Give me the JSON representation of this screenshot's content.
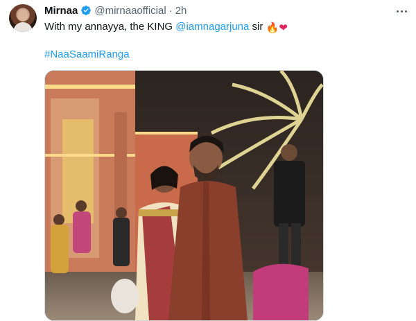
{
  "tweet": {
    "author_name": "Mirnaa",
    "handle": "@mirnaaofficial",
    "separator": "·",
    "time": "2h",
    "text_before": "With my annayya, the KING ",
    "mention": "@iamnagarjuna",
    "text_after": " sir ",
    "emoji_fire": "🔥",
    "emoji_heart": "❤",
    "hashtag": "#NaaSaamiRanga"
  },
  "icons": {
    "avatar": "profile-photo",
    "verified": "verified-badge-icon",
    "more": "more-options-icon"
  },
  "colors": {
    "link": "#1d9bf0",
    "secondary_text": "#536471",
    "primary_text": "#0f1419",
    "verified_blue": "#1d9bf0"
  }
}
